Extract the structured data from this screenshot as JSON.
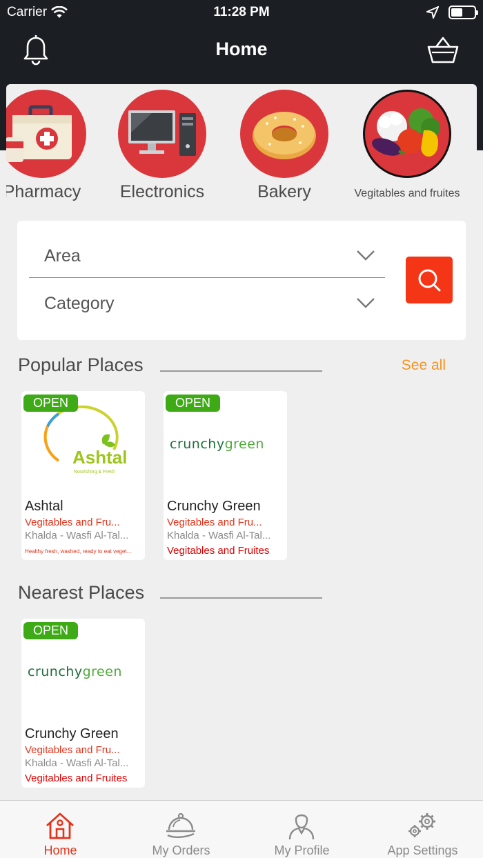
{
  "status_bar": {
    "carrier": "Carrier",
    "time": "11:28 PM"
  },
  "header": {
    "title": "Home"
  },
  "categories": [
    {
      "label": "Pharmacy",
      "icon": "first-aid-kit-icon"
    },
    {
      "label": "Electronics",
      "icon": "computer-icon"
    },
    {
      "label": "Bakery",
      "icon": "bagel-icon"
    },
    {
      "label": "Vegitables and fruites",
      "icon": "vegetables-icon",
      "selected": true
    }
  ],
  "filters": {
    "area_label": "Area",
    "category_label": "Category"
  },
  "popular": {
    "title": "Popular Places",
    "see_all": "See all",
    "places": [
      {
        "status": "OPEN",
        "logo": "Ashtal",
        "logo_sub": "Nourishing & Fresh",
        "name": "Ashtal",
        "category": "Vegitables and Fru...",
        "address": "Khalda - Wasfi Al-Tal...",
        "description": "Healthy fresh, washed, ready to eat veget..."
      },
      {
        "status": "OPEN",
        "logo": "crunchygreen",
        "name": "Crunchy Green",
        "category": "Vegitables and Fru...",
        "address": "Khalda - Wasfi Al-Tal...",
        "tag": "Vegitables and Fruites"
      }
    ]
  },
  "nearest": {
    "title": "Nearest Places",
    "places": [
      {
        "status": "OPEN",
        "logo": "crunchygreen",
        "name": "Crunchy Green",
        "category": "Vegitables and Fru...",
        "address": "Khalda - Wasfi Al-Tal...",
        "tag": "Vegitables and Fruites"
      }
    ]
  },
  "tabs": [
    {
      "label": "Home",
      "icon": "home-icon",
      "active": true
    },
    {
      "label": "My Orders",
      "icon": "cloche-icon"
    },
    {
      "label": "My Profile",
      "icon": "user-icon"
    },
    {
      "label": "App Settings",
      "icon": "gears-icon"
    }
  ],
  "colors": {
    "accent": "#e3321a",
    "search": "#f43516",
    "open": "#3daa16",
    "see_all": "#f7941d",
    "category_bg": "#d9373c",
    "header_bg": "#1b1f23"
  }
}
